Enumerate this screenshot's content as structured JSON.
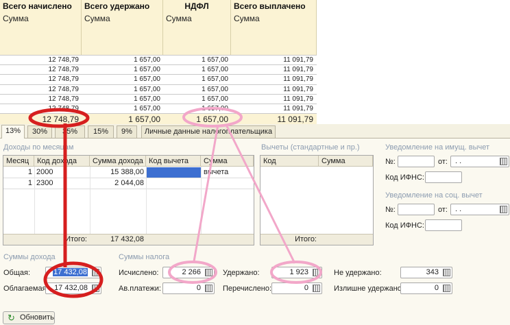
{
  "top_table": {
    "headers": [
      {
        "title": "Всего начислено",
        "sub": "Сумма"
      },
      {
        "title": "Всего удержано",
        "sub": "Сумма"
      },
      {
        "title": "НДФЛ",
        "sub": "Сумма"
      },
      {
        "title": "Всего выплачено",
        "sub": "Сумма"
      }
    ],
    "rows": [
      [
        "12 748,79",
        "1 657,00",
        "1 657,00",
        "11 091,79"
      ],
      [
        "12 748,79",
        "1 657,00",
        "1 657,00",
        "11 091,79"
      ],
      [
        "12 748,79",
        "1 657,00",
        "1 657,00",
        "11 091,79"
      ],
      [
        "12 748,79",
        "1 657,00",
        "1 657,00",
        "11 091,79"
      ],
      [
        "12 748,79",
        "1 657,00",
        "1 657,00",
        "11 091,79"
      ],
      [
        "12 748,79",
        "1 657,00",
        "1 657,00",
        "11 091,79"
      ]
    ],
    "totals": [
      "12 748,79",
      "1 657,00",
      "1 657,00",
      "11 091,79"
    ]
  },
  "tabs": [
    "13%",
    "30%",
    "35%",
    "15%",
    "9%",
    "Личные данные налогоплательщика"
  ],
  "active_tab": "13%",
  "income": {
    "section": "Доходы по месяцам",
    "headers": [
      "Месяц",
      "Код дохода",
      "Сумма дохода",
      "Код вычета",
      "Сумма вычета"
    ],
    "rows": [
      [
        "1",
        "2000",
        "15 388,00",
        "",
        ""
      ],
      [
        "1",
        "2300",
        "2 044,08",
        "",
        ""
      ]
    ],
    "total_label": "Итого:",
    "total_value": "17 432,08"
  },
  "deductions": {
    "section": "Вычеты (стандартные и пр.)",
    "headers": [
      "Код",
      "Сумма"
    ],
    "total_label": "Итого:"
  },
  "notice_property": {
    "section": "Уведомление на имущ. вычет",
    "no_label": "№:",
    "from_label": "от:",
    "date_value": " .  .",
    "ifns_label": "Код ИФНС:"
  },
  "notice_social": {
    "section": "Уведомление на соц. вычет",
    "no_label": "№:",
    "from_label": "от:",
    "date_value": " .  .",
    "ifns_label": "Код ИФНС:"
  },
  "income_sums": {
    "section": "Суммы дохода",
    "total_label": "Общая:",
    "total_value": "17 432,08",
    "taxable_label": "Облагаемая:",
    "taxable_value": "17 432,08"
  },
  "tax_sums": {
    "section": "Суммы налога",
    "calculated_label": "Исчислено:",
    "calculated_value": "2 266",
    "advance_label": "Ав.платежи:",
    "advance_value": "0",
    "withheld_label": "Удержано:",
    "withheld_value": "1 923",
    "transferred_label": "Перечислено:",
    "transferred_value": "0",
    "not_withheld_label": "Не удержано:",
    "not_withheld_value": "343",
    "overwithheld_label": "Излишне удержано:",
    "overwithheld_value": "0"
  },
  "refresh_label": "Обновить",
  "colors": {
    "header_bg": "#fbf3d4",
    "panel_bg": "#fbf9f0",
    "section_text": "#8c9cb0",
    "red_mark": "#d61f1f",
    "pink_mark": "#f2a7c9",
    "selection": "#3d6fd1"
  }
}
